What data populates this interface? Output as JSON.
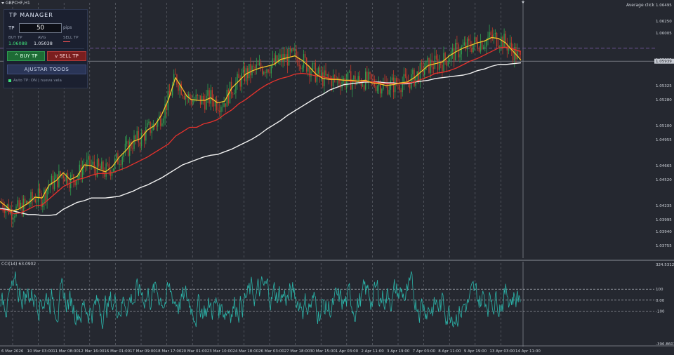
{
  "window": {
    "symbol": "GBPCHF,H1",
    "average_click_label": "Average click"
  },
  "price_scale": {
    "labels": [
      "1.06495",
      "1.06250",
      "1.06005",
      "1.05625",
      "1.05325",
      "1.05280",
      "1.05100",
      "1.04955",
      "1.04665",
      "1.04520",
      "1.04235",
      "1.03995",
      "1.03940",
      "1.03755"
    ],
    "current_price": "1.05939"
  },
  "time_axis": {
    "labels": [
      "6 Mar 2026",
      "10 Mar 03:00",
      "11 Mar 08:00",
      "12 Mar 16:00",
      "16 Mar 01:00",
      "17 Mar 09:00",
      "18 Mar 17:00",
      "20 Mar 01:00",
      "23 Mar 10:00",
      "24 Mar 18:00",
      "26 Mar 03:00",
      "27 Mar 18:00",
      "30 Mar 15:00",
      "1 Apr 03:00",
      "2 Apr 11:00",
      "3 Apr 19:00",
      "7 Apr 03:00",
      "8 Apr 11:00",
      "9 Apr 19:00",
      "13 Apr 03:00",
      "14 Apr 11:00"
    ]
  },
  "indicator": {
    "label": "CCI(14) 63.0902",
    "scale_labels": [
      "324.5312",
      "100",
      "0.00",
      "-100",
      "-396.8601"
    ]
  },
  "tp_manager": {
    "title": "TP MANAGER",
    "tp_label": "TP",
    "tp_value": "50",
    "tp_unit": "pips",
    "buy_tp_label": "BUY TP",
    "buy_tp_value": "1.06088",
    "avg_label": "AVG",
    "avg_value": "1.05038",
    "sell_tp_label": "SELL TP",
    "buy_button": "^ BUY TP",
    "sell_button": "v SELL TP",
    "adjust_button": "AJUSTAR TODOS",
    "auto_status": "Auto TP: ON | nueva vela"
  },
  "colors": {
    "background": "#252830",
    "bull": "#2f9e4f",
    "bear": "#c0392b",
    "ma_fast": "#f6c32a",
    "ma_mid": "#e8322c",
    "ma_slow": "#f2f2f2",
    "cci": "#2bb3a8",
    "tp_line": "#7a5aa6"
  },
  "chart_data": {
    "type": "candlestick",
    "symbol": "GBPCHF",
    "timeframe": "H1",
    "price_range": [
      1.0368,
      1.0656
    ],
    "current_price": 1.05939,
    "buy_tp": 1.06088,
    "ma_fast_path": [
      [
        0,
        1.0433
      ],
      [
        8,
        1.0428
      ],
      [
        16,
        1.0422
      ],
      [
        26,
        1.0424
      ],
      [
        40,
        1.0431
      ],
      [
        50,
        1.0438
      ],
      [
        60,
        1.0437
      ],
      [
        70,
        1.0452
      ],
      [
        80,
        1.0457
      ],
      [
        90,
        1.0466
      ],
      [
        100,
        1.0458
      ],
      [
        110,
        1.0462
      ],
      [
        120,
        1.0475
      ],
      [
        130,
        1.0474
      ],
      [
        140,
        1.047
      ],
      [
        150,
        1.0467
      ],
      [
        160,
        1.0473
      ],
      [
        170,
        1.0484
      ],
      [
        180,
        1.0492
      ],
      [
        190,
        1.0502
      ],
      [
        200,
        1.0505
      ],
      [
        210,
        1.0515
      ],
      [
        220,
        1.052
      ],
      [
        230,
        1.0532
      ],
      [
        240,
        1.055
      ],
      [
        250,
        1.0575
      ],
      [
        260,
        1.0562
      ],
      [
        266,
        1.0554
      ],
      [
        272,
        1.055
      ],
      [
        282,
        1.0549
      ],
      [
        292,
        1.0549
      ],
      [
        300,
        1.0552
      ],
      [
        310,
        1.0546
      ],
      [
        320,
        1.0548
      ],
      [
        330,
        1.0563
      ],
      [
        340,
        1.0571
      ],
      [
        350,
        1.0579
      ],
      [
        360,
        1.0583
      ],
      [
        370,
        1.0586
      ],
      [
        380,
        1.0588
      ],
      [
        390,
        1.059
      ],
      [
        400,
        1.0596
      ],
      [
        410,
        1.0598
      ],
      [
        420,
        1.06
      ],
      [
        430,
        1.0595
      ],
      [
        440,
        1.0588
      ],
      [
        450,
        1.0579
      ],
      [
        460,
        1.0574
      ],
      [
        470,
        1.0573
      ],
      [
        480,
        1.0573
      ],
      [
        490,
        1.0572
      ],
      [
        500,
        1.0572
      ],
      [
        510,
        1.0571
      ],
      [
        520,
        1.0572
      ],
      [
        530,
        1.0569
      ],
      [
        540,
        1.0568
      ],
      [
        550,
        1.0566
      ],
      [
        560,
        1.0567
      ],
      [
        570,
        1.0569
      ],
      [
        580,
        1.057
      ],
      [
        590,
        1.0575
      ],
      [
        600,
        1.0582
      ],
      [
        610,
        1.0589
      ],
      [
        620,
        1.0591
      ],
      [
        630,
        1.0593
      ],
      [
        640,
        1.06
      ],
      [
        650,
        1.0605
      ],
      [
        660,
        1.0609
      ],
      [
        670,
        1.0612
      ],
      [
        680,
        1.0615
      ],
      [
        690,
        1.0617
      ],
      [
        700,
        1.0621
      ],
      [
        710,
        1.062
      ],
      [
        720,
        1.0615
      ],
      [
        730,
        1.0606
      ],
      [
        738,
        1.0599
      ],
      [
        742,
        1.0595
      ]
    ],
    "ma_mid_path": [
      [
        0,
        1.0424
      ],
      [
        10,
        1.0423
      ],
      [
        20,
        1.0419
      ],
      [
        30,
        1.042
      ],
      [
        40,
        1.0424
      ],
      [
        50,
        1.0428
      ],
      [
        60,
        1.0429
      ],
      [
        70,
        1.0436
      ],
      [
        80,
        1.0443
      ],
      [
        90,
        1.045
      ],
      [
        100,
        1.0454
      ],
      [
        110,
        1.0458
      ],
      [
        120,
        1.046
      ],
      [
        130,
        1.0463
      ],
      [
        140,
        1.0465
      ],
      [
        150,
        1.0465
      ],
      [
        160,
        1.0466
      ],
      [
        170,
        1.0469
      ],
      [
        180,
        1.0472
      ],
      [
        190,
        1.0476
      ],
      [
        200,
        1.048
      ],
      [
        210,
        1.0484
      ],
      [
        220,
        1.0489
      ],
      [
        230,
        1.0494
      ],
      [
        240,
        1.0499
      ],
      [
        250,
        1.0508
      ],
      [
        260,
        1.0513
      ],
      [
        270,
        1.0518
      ],
      [
        280,
        1.0518
      ],
      [
        290,
        1.0522
      ],
      [
        300,
        1.0524
      ],
      [
        310,
        1.0527
      ],
      [
        320,
        1.0533
      ],
      [
        330,
        1.0538
      ],
      [
        340,
        1.0545
      ],
      [
        350,
        1.055
      ],
      [
        360,
        1.0556
      ],
      [
        370,
        1.0562
      ],
      [
        380,
        1.0567
      ],
      [
        390,
        1.0571
      ],
      [
        400,
        1.0574
      ],
      [
        410,
        1.0576
      ],
      [
        420,
        1.0579
      ],
      [
        430,
        1.058
      ],
      [
        440,
        1.0579
      ],
      [
        450,
        1.0577
      ],
      [
        460,
        1.0576
      ],
      [
        470,
        1.0574
      ],
      [
        480,
        1.0573
      ],
      [
        490,
        1.0572
      ],
      [
        500,
        1.0571
      ],
      [
        510,
        1.0571
      ],
      [
        520,
        1.0571
      ],
      [
        530,
        1.057
      ],
      [
        540,
        1.0569
      ],
      [
        550,
        1.0568
      ],
      [
        560,
        1.0568
      ],
      [
        570,
        1.0568
      ],
      [
        580,
        1.0569
      ],
      [
        590,
        1.057
      ],
      [
        600,
        1.0573
      ],
      [
        610,
        1.0576
      ],
      [
        620,
        1.058
      ],
      [
        630,
        1.0581
      ],
      [
        640,
        1.0583
      ],
      [
        650,
        1.0586
      ],
      [
        660,
        1.059
      ],
      [
        670,
        1.0594
      ],
      [
        680,
        1.0597
      ],
      [
        690,
        1.0601
      ],
      [
        700,
        1.0605
      ],
      [
        710,
        1.0609
      ],
      [
        720,
        1.061
      ],
      [
        730,
        1.0608
      ],
      [
        742,
        1.0605
      ]
    ],
    "ma_slow_path": [
      [
        0,
        1.0425
      ],
      [
        10,
        1.0424
      ],
      [
        20,
        1.0422
      ],
      [
        30,
        1.042
      ],
      [
        40,
        1.0418
      ],
      [
        50,
        1.0418
      ],
      [
        60,
        1.0417
      ],
      [
        70,
        1.0417
      ],
      [
        80,
        1.0418
      ],
      [
        90,
        1.0424
      ],
      [
        100,
        1.0428
      ],
      [
        110,
        1.0432
      ],
      [
        120,
        1.0434
      ],
      [
        130,
        1.0437
      ],
      [
        140,
        1.0437
      ],
      [
        150,
        1.0437
      ],
      [
        160,
        1.0438
      ],
      [
        170,
        1.0439
      ],
      [
        180,
        1.0442
      ],
      [
        190,
        1.0445
      ],
      [
        200,
        1.0449
      ],
      [
        210,
        1.0452
      ],
      [
        220,
        1.0456
      ],
      [
        230,
        1.046
      ],
      [
        240,
        1.0465
      ],
      [
        250,
        1.047
      ],
      [
        260,
        1.0475
      ],
      [
        270,
        1.0478
      ],
      [
        280,
        1.0481
      ],
      [
        290,
        1.0484
      ],
      [
        300,
        1.0486
      ],
      [
        310,
        1.0487
      ],
      [
        320,
        1.049
      ],
      [
        330,
        1.0493
      ],
      [
        340,
        1.0497
      ],
      [
        350,
        1.0501
      ],
      [
        360,
        1.0505
      ],
      [
        370,
        1.051
      ],
      [
        380,
        1.0516
      ],
      [
        390,
        1.0521
      ],
      [
        400,
        1.0526
      ],
      [
        410,
        1.0532
      ],
      [
        420,
        1.0537
      ],
      [
        430,
        1.0542
      ],
      [
        440,
        1.0547
      ],
      [
        450,
        1.0552
      ],
      [
        460,
        1.0556
      ],
      [
        470,
        1.0561
      ],
      [
        480,
        1.0564
      ],
      [
        490,
        1.0567
      ],
      [
        500,
        1.0568
      ],
      [
        510,
        1.0569
      ],
      [
        520,
        1.057
      ],
      [
        530,
        1.057
      ],
      [
        540,
        1.057
      ],
      [
        550,
        1.0569
      ],
      [
        560,
        1.0569
      ],
      [
        570,
        1.0568
      ],
      [
        580,
        1.0568
      ],
      [
        590,
        1.057
      ],
      [
        600,
        1.0571
      ],
      [
        610,
        1.0572
      ],
      [
        620,
        1.0574
      ],
      [
        630,
        1.0575
      ],
      [
        640,
        1.0576
      ],
      [
        650,
        1.0577
      ],
      [
        660,
        1.0578
      ],
      [
        670,
        1.058
      ],
      [
        680,
        1.0583
      ],
      [
        690,
        1.0585
      ],
      [
        700,
        1.0588
      ],
      [
        710,
        1.059
      ],
      [
        720,
        1.059
      ],
      [
        730,
        1.0591
      ],
      [
        742,
        1.0592
      ]
    ],
    "cci_range": [
      -396.8601,
      324.5312
    ],
    "cci_levels": [
      100,
      0,
      -100
    ]
  }
}
